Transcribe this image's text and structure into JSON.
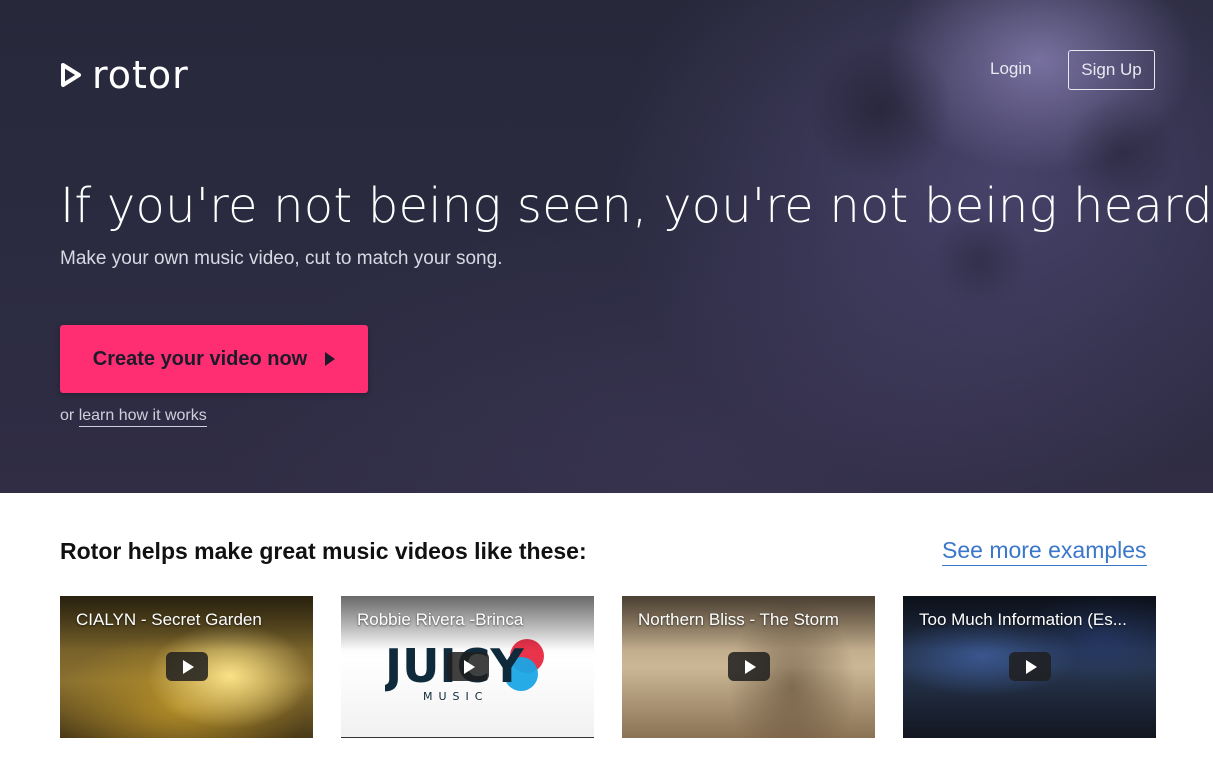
{
  "brand": {
    "name": "rotor",
    "logo_icon": "play-triangle-icon"
  },
  "nav": {
    "login": "Login",
    "signup": "Sign Up"
  },
  "hero": {
    "headline": "If you're not being seen, you're not being heard.",
    "subheadline": "Make your own music video, cut to match your song.",
    "cta_label": "Create your video now",
    "cta_icon": "play-arrow-icon",
    "alt_prefix": "or",
    "alt_link": "learn how it works"
  },
  "examples": {
    "title": "Rotor helps make great music videos like these:",
    "see_more": "See more examples",
    "videos": [
      {
        "title": "CIALYN - Secret Garden",
        "icon": "play-button-icon"
      },
      {
        "title": "Robbie Rivera -Brinca",
        "icon": "play-button-icon",
        "logo_text": "JUICY",
        "logo_subtext": "MUSIC"
      },
      {
        "title": "Northern Bliss - The Storm",
        "icon": "play-button-icon"
      },
      {
        "title": "Too Much Information (Es...",
        "icon": "play-button-icon"
      }
    ]
  },
  "colors": {
    "accent": "#ff2d71",
    "link": "#3a76c9",
    "hero_bg": "#2b2b41"
  }
}
